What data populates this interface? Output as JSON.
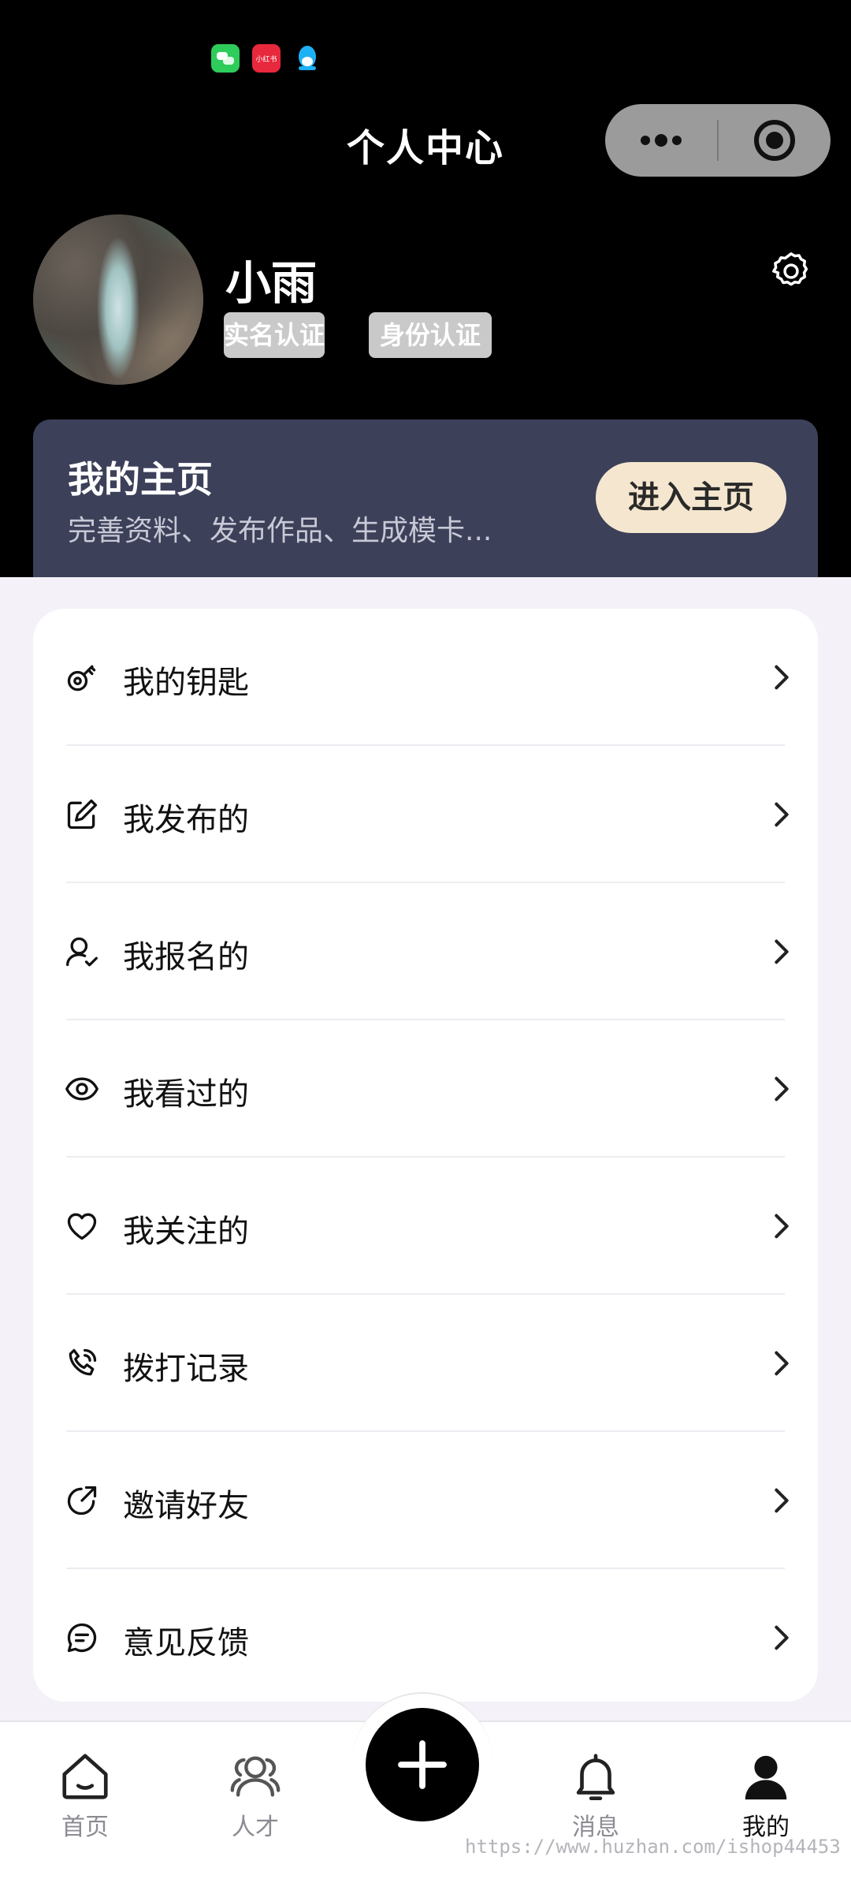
{
  "status_bar": {
    "notifications": [
      {
        "name": "wechat-notification-icon"
      },
      {
        "name": "xiaohongshu-notification-icon",
        "text": "小红书"
      },
      {
        "name": "qq-notification-icon"
      }
    ]
  },
  "header": {
    "title": "个人中心"
  },
  "profile": {
    "name": "小雨",
    "badges": [
      "实名认证",
      "身份认证"
    ]
  },
  "home_card": {
    "title": "我的主页",
    "subtitle": "完善资料、发布作品、生成模卡...",
    "button_label": "进入主页"
  },
  "menu": {
    "items": [
      {
        "label": "我的钥匙",
        "icon": "key-icon"
      },
      {
        "label": "我发布的",
        "icon": "edit-icon"
      },
      {
        "label": "我报名的",
        "icon": "user-check-icon"
      },
      {
        "label": "我看过的",
        "icon": "eye-icon"
      },
      {
        "label": "我关注的",
        "icon": "heart-icon"
      },
      {
        "label": "拨打记录",
        "icon": "phone-icon"
      },
      {
        "label": "邀请好友",
        "icon": "share-icon"
      },
      {
        "label": "意见反馈",
        "icon": "feedback-icon"
      }
    ]
  },
  "tabbar": {
    "items": [
      {
        "label": "首页",
        "icon": "home-icon",
        "active": false
      },
      {
        "label": "人才",
        "icon": "people-icon",
        "active": false
      },
      {
        "label": "消息",
        "icon": "bell-icon",
        "active": false
      },
      {
        "label": "我的",
        "icon": "user-icon",
        "active": true
      }
    ],
    "center_button": "plus-icon"
  },
  "watermark": "https://www.huzhan.com/ishop44453",
  "colors": {
    "header_bg": "#000000",
    "home_card_bg": "#3d4059",
    "enter_button_bg": "#f5e7cf",
    "page_bg": "#f4f2f8",
    "badge_bg": "#c9c9c9"
  }
}
